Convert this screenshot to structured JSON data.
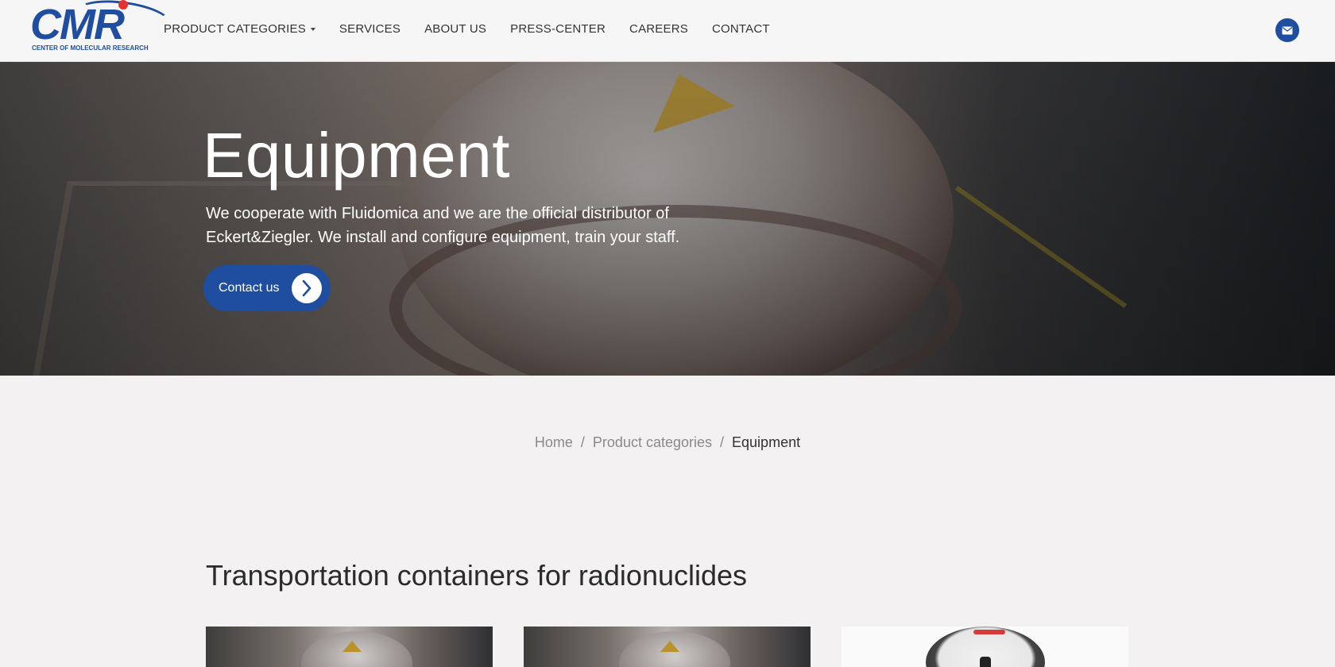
{
  "brand": {
    "logo_text": "CMR",
    "logo_subtitle": "CENTER OF MOLECULAR RESEARCH",
    "colors": {
      "primary": "#1f4ea1",
      "accent_dot": "#e3342f"
    }
  },
  "nav": {
    "items": [
      {
        "label": "PRODUCT CATEGORIES",
        "has_dropdown": true
      },
      {
        "label": "SERVICES"
      },
      {
        "label": "ABOUT US"
      },
      {
        "label": "PRESS-CENTER"
      },
      {
        "label": "CAREERS"
      },
      {
        "label": "CONTACT"
      }
    ],
    "mail_icon": "envelope-icon"
  },
  "hero": {
    "title": "Equipment",
    "description": "We cooperate with Fluidomica and we are the official distributor of Eckert&Ziegler. We install and configure equipment, train your staff.",
    "cta_label": "Contact us",
    "cta_icon": "chevron-right-icon"
  },
  "breadcrumb": {
    "items": [
      "Home",
      "Product categories"
    ],
    "current": "Equipment",
    "separator": "/"
  },
  "section": {
    "title": "Transportation containers for radionuclides",
    "cards": [
      {
        "image": "container-photo"
      },
      {
        "image": "container-photo"
      },
      {
        "image": "dosimeter-device-photo"
      }
    ]
  }
}
